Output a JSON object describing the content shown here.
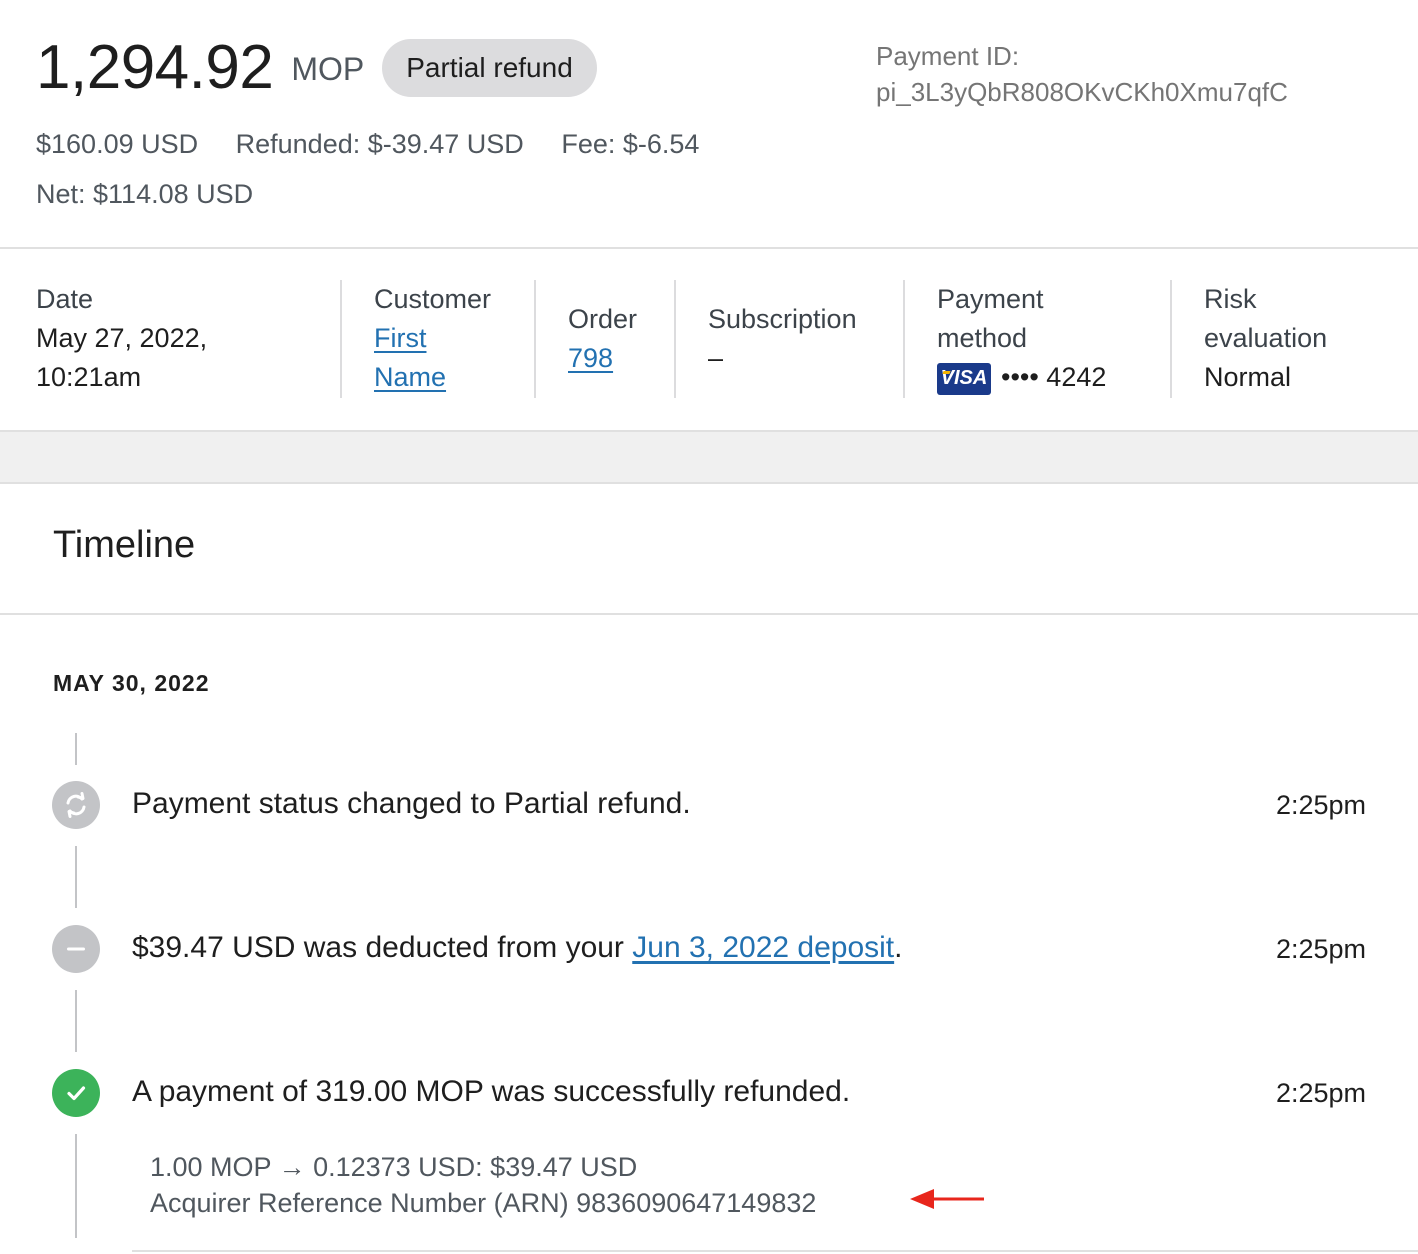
{
  "header": {
    "amount": "1,294.92",
    "currency": "MOP",
    "status": "Partial refund",
    "payment_id_label": "Payment ID:",
    "payment_id": "pi_3L3yQbR808OKvCKh0Xmu7qfC",
    "summary": {
      "usd_amount": "$160.09 USD",
      "refunded": "Refunded: $-39.47 USD",
      "fee": "Fee: $-6.54",
      "net": "Net: $114.08 USD"
    }
  },
  "details": {
    "date": {
      "label": "Date",
      "line1": "May 27, 2022,",
      "line2": "10:21am"
    },
    "customer": {
      "label": "Customer",
      "link_line1": "First",
      "link_line2": "Name"
    },
    "order": {
      "label": "Order",
      "link": "798"
    },
    "subscription": {
      "label": "Subscription",
      "value": "–"
    },
    "payment_method": {
      "label_line1": "Payment",
      "label_line2": "method",
      "brand": "VISA",
      "masked": "•••• 4242"
    },
    "risk": {
      "label_line1": "Risk",
      "label_line2": "evaluation",
      "value": "Normal"
    }
  },
  "timeline": {
    "title": "Timeline",
    "date_heading": "MAY 30, 2022",
    "events": [
      {
        "icon": "refresh-icon",
        "text": "Payment status changed to Partial refund.",
        "time": "2:25pm"
      },
      {
        "icon": "minus-icon",
        "text_before": "$39.47 USD was deducted from your ",
        "link": "Jun 3, 2022 deposit",
        "text_after": ".",
        "time": "2:25pm"
      },
      {
        "icon": "check-icon",
        "text": "A payment of 319.00 MOP was successfully refunded.",
        "time": "2:25pm",
        "detail_line1": "1.00 MOP → 0.12373 USD: $39.47 USD",
        "detail_line2": "Acquirer Reference Number (ARN) 9836090647149832"
      }
    ]
  },
  "colors": {
    "link": "#2271b1",
    "success": "#3cb35a",
    "neutral_icon": "#c3c4c7",
    "annotation_arrow": "#e8261c"
  }
}
